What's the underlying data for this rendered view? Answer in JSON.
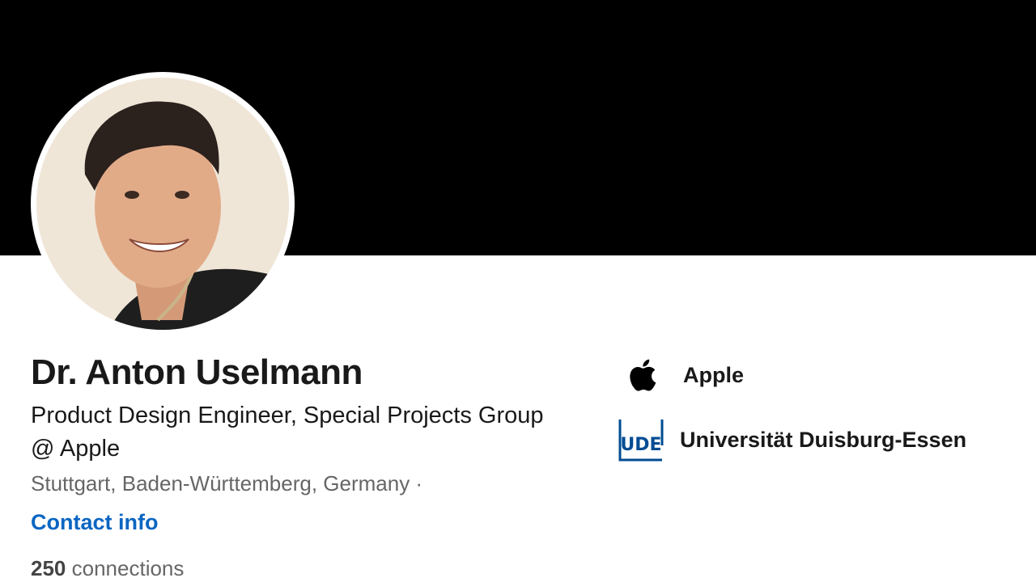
{
  "profile": {
    "name": "Dr. Anton Uselmann",
    "headline": "Product Design Engineer, Special Projects Group @ Apple",
    "location": "Stuttgart, Baden-Württemberg, Germany ·",
    "contact_info_label": "Contact info",
    "connections_count": "250",
    "connections_label": "connections"
  },
  "organizations": [
    {
      "name": "Apple",
      "logo": "apple-logo-icon"
    },
    {
      "name": "Universität Duisburg-Essen",
      "logo_text": "UDE",
      "logo": "ude-logo-icon"
    }
  ],
  "colors": {
    "banner": "#000000",
    "link": "#0a66c2",
    "text_primary": "#191919",
    "text_secondary": "#666666",
    "ude_blue": "#004c93"
  }
}
